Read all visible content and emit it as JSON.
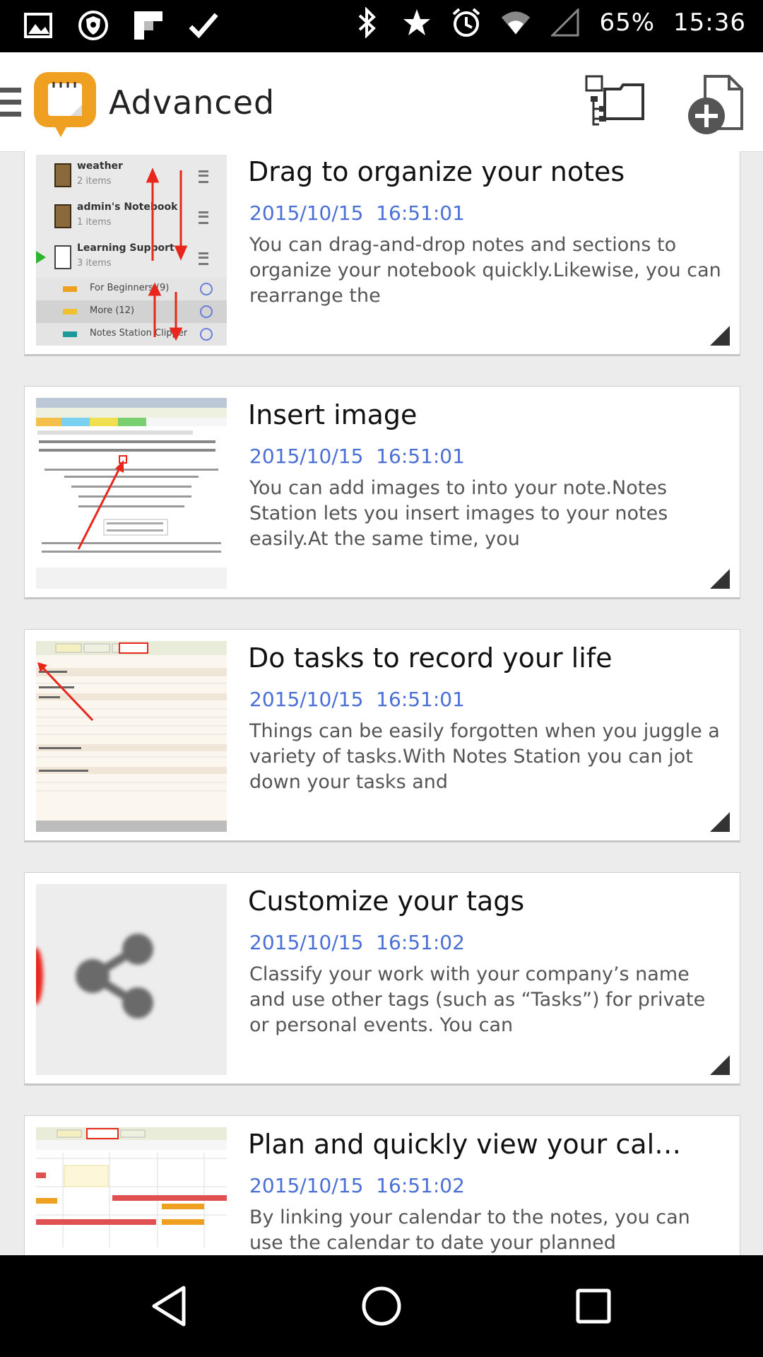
{
  "status_bar": {
    "battery": "65%",
    "time": "15:36",
    "left_icons": [
      "gallery-icon",
      "vpn-shield-icon",
      "flipboard-icon",
      "check-icon"
    ],
    "right_icons": [
      "bluetooth-icon",
      "star-icon",
      "alarm-icon",
      "wifi-icon",
      "signal-icon"
    ]
  },
  "app_bar": {
    "title": "Advanced",
    "icons": [
      "menu-icon",
      "notes-station-logo",
      "organize-icon",
      "add-note-icon"
    ]
  },
  "notes": [
    {
      "title": "Drag to organize your notes",
      "date": "2015/10/15  16:51:01",
      "body": "You can drag-and-drop notes and sections to organize your notebook quickly.Likewise, you can rearrange the",
      "thumbnail": {
        "notebooks": [
          {
            "name": "weather",
            "count": "2 items"
          },
          {
            "name": "admin's Notebook",
            "count": "1 items"
          },
          {
            "name": "Learning Support",
            "count": "3 items"
          }
        ],
        "sections": [
          {
            "name": "For Beginners (9)",
            "color": "#f0a020"
          },
          {
            "name": "More (12)",
            "color": "#f0c030"
          },
          {
            "name": "Notes Station Clipper",
            "color": "#1a9a9a"
          }
        ]
      }
    },
    {
      "title": "Insert image",
      "date": "2015/10/15  16:51:01",
      "body": "You can add images to into your note.Notes Station lets you insert images to your notes easily.At the same time, you"
    },
    {
      "title": "Do tasks to record your life",
      "date": "2015/10/15  16:51:01",
      "body": "Things can be easily forgotten when you juggle a variety of tasks.With Notes Station you can jot down your tasks and"
    },
    {
      "title": "Customize your tags",
      "date": "2015/10/15  16:51:02",
      "body": "Classify your work with your company’s name and use other tags (such as “Tasks”) for private or personal events. You can"
    },
    {
      "title": "Plan and quickly view your cal…",
      "date": "2015/10/15  16:51:02",
      "body": "By linking your calendar to the notes, you can use the calendar to date your planned"
    }
  ],
  "nav_bar": {
    "icons": [
      "back-icon",
      "home-icon",
      "recent-apps-icon"
    ]
  },
  "colors": {
    "accent_date": "#4a6fd6",
    "annotation_arrow": "#e8261c",
    "logo_orange": "#f0a020"
  }
}
